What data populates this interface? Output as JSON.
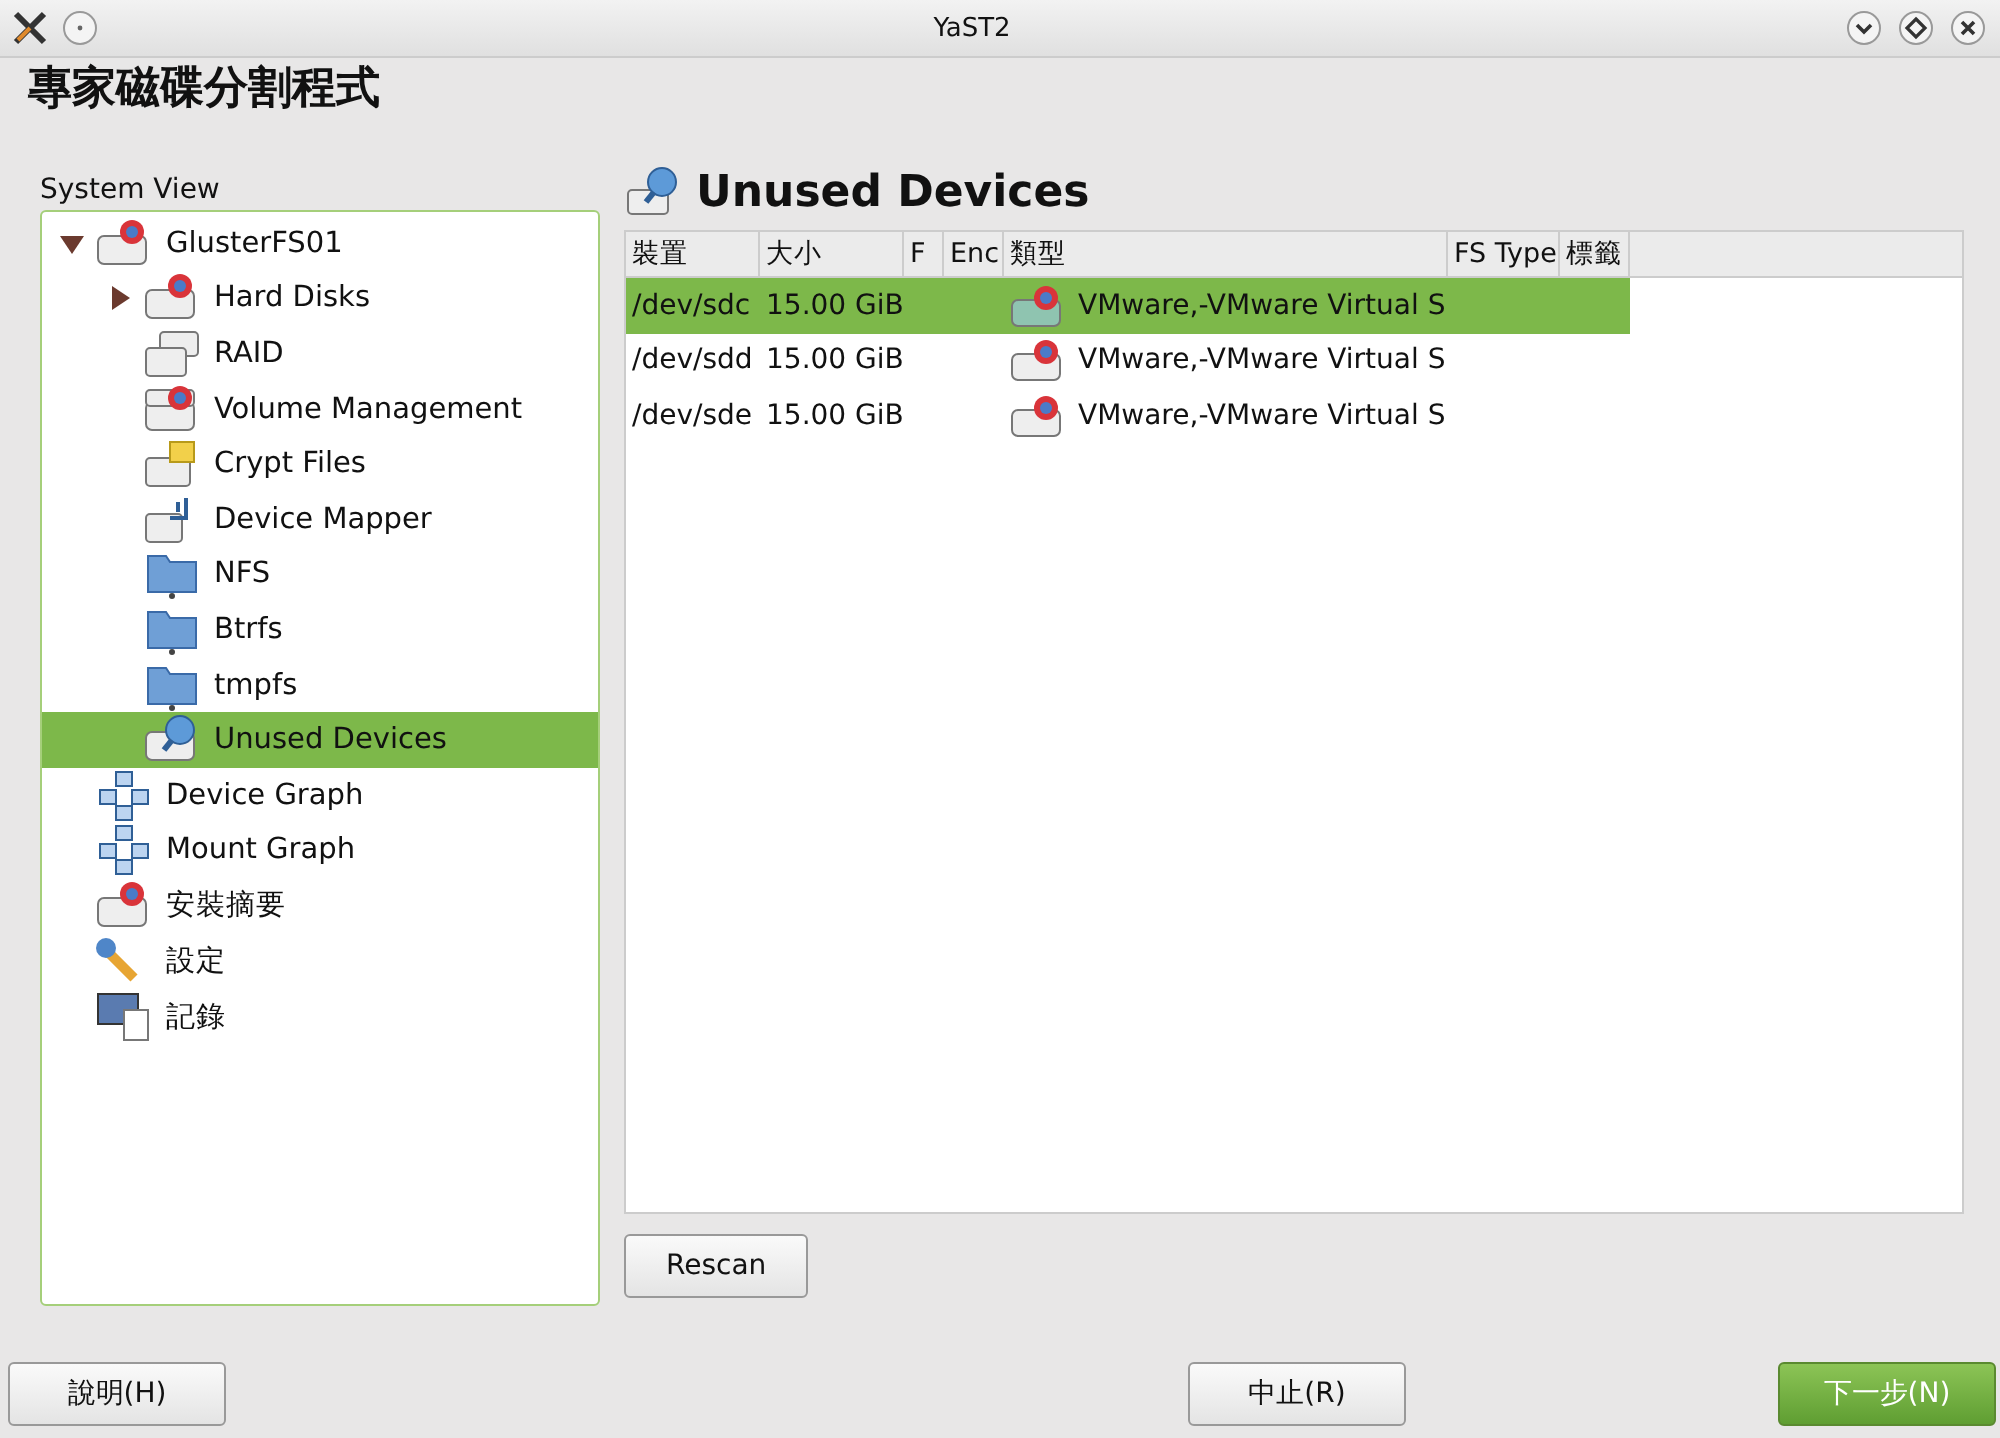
{
  "window": {
    "title": "YaST2"
  },
  "heading": "專家磁碟分割程式",
  "system_view": {
    "label": "System View",
    "tree": [
      {
        "label": "GlusterFS01",
        "kind": "disk",
        "selected": false,
        "expanded": true,
        "children": [
          {
            "label": "Hard Disks",
            "kind": "disk",
            "selected": false,
            "expanded": false
          },
          {
            "label": "RAID",
            "kind": "raid",
            "selected": false
          },
          {
            "label": "Volume Management",
            "kind": "lvm",
            "selected": false
          },
          {
            "label": "Crypt Files",
            "kind": "crypt",
            "selected": false
          },
          {
            "label": "Device Mapper",
            "kind": "mapper",
            "selected": false
          },
          {
            "label": "NFS",
            "kind": "folder",
            "selected": false
          },
          {
            "label": "Btrfs",
            "kind": "folder",
            "selected": false
          },
          {
            "label": "tmpfs",
            "kind": "folder",
            "selected": false
          },
          {
            "label": "Unused Devices",
            "kind": "unused",
            "selected": true
          }
        ]
      },
      {
        "label": "Device Graph",
        "kind": "graph",
        "selected": false
      },
      {
        "label": "Mount Graph",
        "kind": "graph",
        "selected": false
      },
      {
        "label": "安裝摘要",
        "kind": "disk",
        "selected": false
      },
      {
        "label": "設定",
        "kind": "settings",
        "selected": false
      },
      {
        "label": "記錄",
        "kind": "log",
        "selected": false
      }
    ]
  },
  "panel": {
    "title": "Unused Devices",
    "table": {
      "columns": [
        "裝置",
        "大小",
        "F",
        "Enc",
        "類型",
        "FS Type",
        "標籤"
      ],
      "rows": [
        {
          "device": "/dev/sdc",
          "size": "15.00 GiB",
          "type": "VMware,-VMware Virtual S",
          "selected": true
        },
        {
          "device": "/dev/sdd",
          "size": "15.00 GiB",
          "type": "VMware,-VMware Virtual S",
          "selected": false
        },
        {
          "device": "/dev/sde",
          "size": "15.00 GiB",
          "type": "VMware,-VMware Virtual S",
          "selected": false
        }
      ]
    },
    "rescan_button": "Rescan"
  },
  "buttons": {
    "help": "說明(H)",
    "abort": "中止(R)",
    "next": "下一步(N)"
  }
}
